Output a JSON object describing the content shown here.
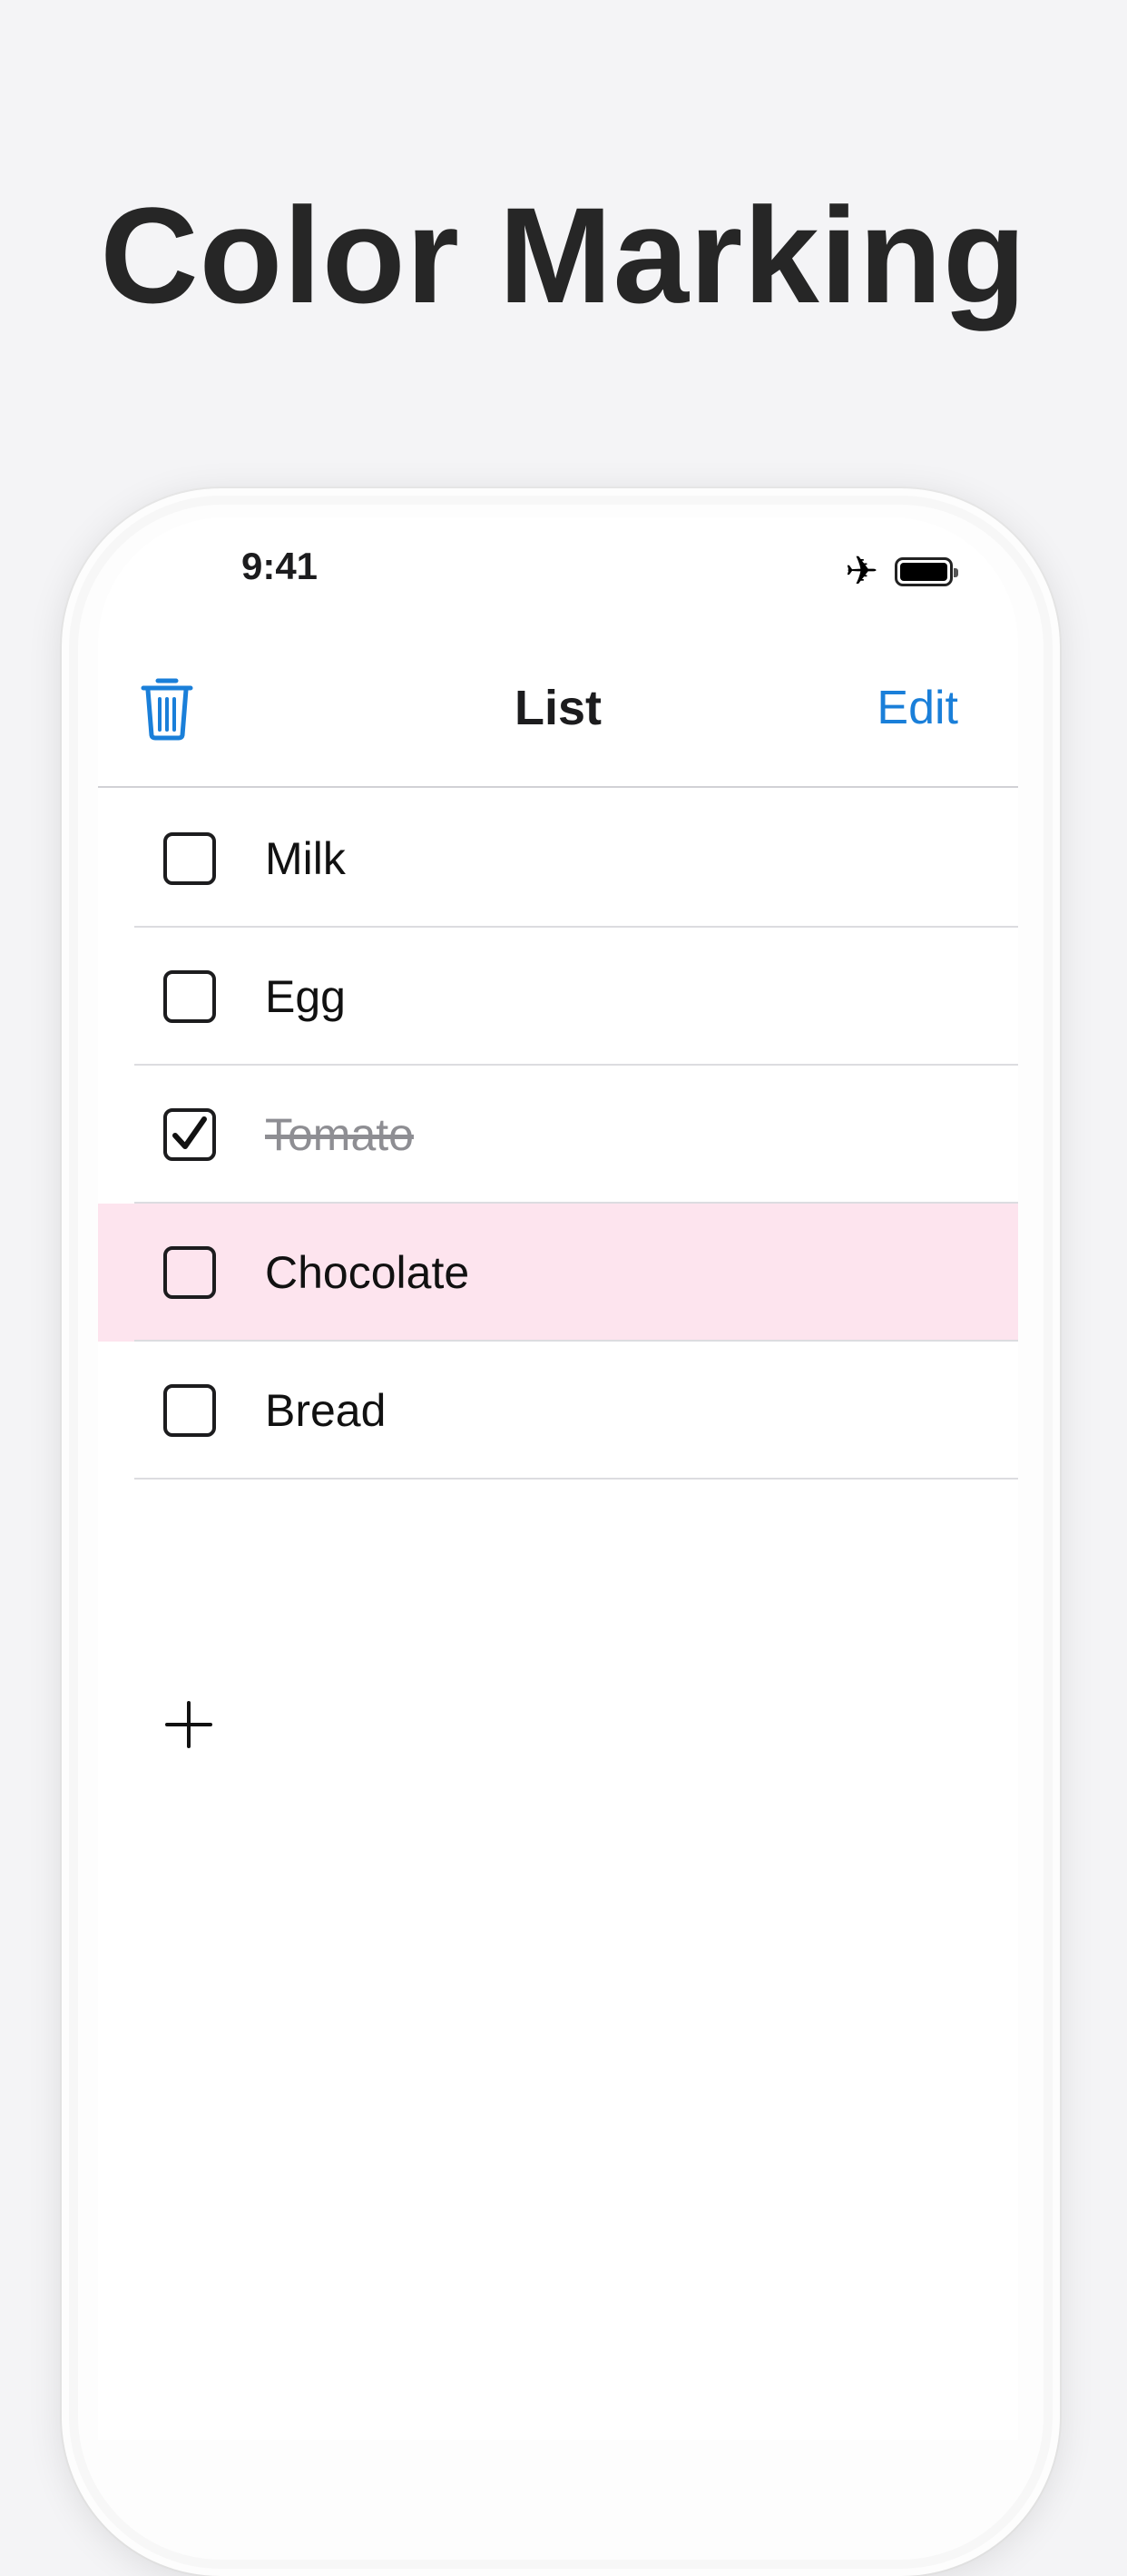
{
  "headline": "Color Marking",
  "status_bar": {
    "time": "9:41",
    "icons": [
      "airplane-icon",
      "battery-icon"
    ]
  },
  "nav": {
    "title": "List",
    "edit_label": "Edit",
    "trash_icon": "trash-icon"
  },
  "items": [
    {
      "label": "Milk",
      "checked": false,
      "highlight": null
    },
    {
      "label": "Egg",
      "checked": false,
      "highlight": null
    },
    {
      "label": "Tomato",
      "checked": true,
      "highlight": null
    },
    {
      "label": "Chocolate",
      "checked": false,
      "highlight": "pink"
    },
    {
      "label": "Bread",
      "checked": false,
      "highlight": null
    }
  ],
  "add_icon": "plus-icon",
  "colors": {
    "accent": "#1a7fd9",
    "highlight_pink": "#fde4ee",
    "background": "#f4f4f6",
    "completed_text": "#8e8e93"
  }
}
